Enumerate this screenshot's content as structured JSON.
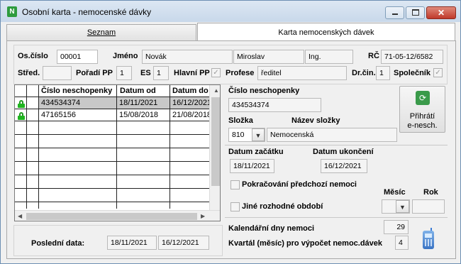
{
  "window": {
    "title": "Osobní karta - nemocenské dávky",
    "icon": "app-icon"
  },
  "tabs": [
    {
      "label": "Seznam"
    },
    {
      "label": "Karta nemocenských dávek"
    }
  ],
  "header": {
    "os_cislo_label": "Os.číslo",
    "os_cislo": "00001",
    "jmeno_label": "Jméno",
    "prijmeni": "Novák",
    "jmeno": "Miroslav",
    "titul": "Ing.",
    "rc_label": "RČ",
    "rc": "71-05-12/6582",
    "stred_label": "Střed.",
    "stred": "",
    "poradi_pp_label": "Pořadí PP",
    "poradi_pp": "1",
    "es_label": "ES",
    "es": "1",
    "hlavni_pp_label": "Hlavní PP",
    "profese_label": "Profese",
    "profese": "ředitel",
    "dr_cin_label": "Dr.čin.",
    "dr_cin": "1",
    "spolecnik_label": "Společník"
  },
  "grid": {
    "columns": [
      "Číslo neschopenky",
      "Datum od",
      "Datum do"
    ],
    "rows": [
      {
        "cislo": "434534374",
        "datum_od": "18/11/2021",
        "datum_do": "16/12/2021"
      },
      {
        "cislo": "47165156",
        "datum_od": "15/08/2018",
        "datum_do": "21/08/2018"
      }
    ]
  },
  "detail": {
    "cislo_neschopenky_label": "Číslo neschopenky",
    "cislo_neschopenky": "434534374",
    "slozka_label": "Složka",
    "slozka": "810",
    "nazev_slozky_label": "Název složky",
    "nazev_slozky": "Nemocenská",
    "prihrati_button": [
      "Přihrátí",
      "e-nesch."
    ],
    "datum_zacatku_label": "Datum začátku",
    "datum_zacatku": "18/11/2021",
    "datum_ukonceni_label": "Datum ukončení",
    "datum_ukonceni": "16/12/2021",
    "pokracovani_label": "Pokračování předchozí nemoci",
    "jine_obdobi_label": "Jiné rozhodné období",
    "mesic_label": "Měsíc",
    "mesic": "",
    "rok_label": "Rok",
    "rok": "",
    "kalendarni_dny_label": "Kalendářní dny nemoci",
    "kalendarni_dny": "29",
    "kvartal_label": "Kvartál (měsíc) pro výpočet nemoc.dávek",
    "kvartal": "4"
  },
  "footer": {
    "posledni_data_label": "Poslední data:",
    "posledni_od": "18/11/2021",
    "posledni_do": "16/12/2021"
  },
  "colors": {
    "accent_green": "#1fb51f",
    "titlebar": "#c8d8ea",
    "close_red": "#c0392b"
  }
}
